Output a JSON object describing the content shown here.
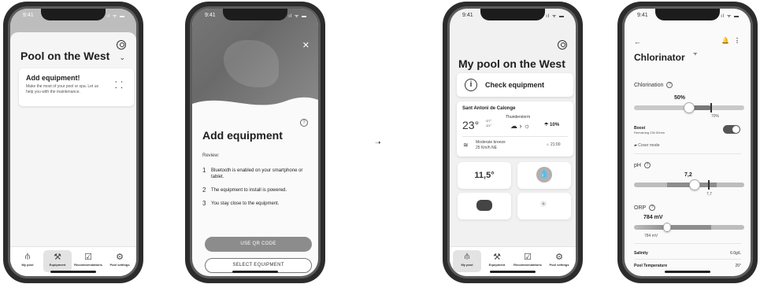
{
  "status": {
    "time": "9:41",
    "signal": "ıl ᯤ ▬"
  },
  "phone1": {
    "title": "Pool on the West",
    "card": {
      "title": "Add equipment!",
      "text": "Make the most of your pool or spa. Let us help you with the maintenance."
    },
    "tabs": [
      {
        "label": "My pool",
        "icon": "pool-ladder-icon",
        "glyph": "⫛"
      },
      {
        "label": "Equipment",
        "icon": "equipment-icon",
        "glyph": "⚒"
      },
      {
        "label": "Recommendations",
        "icon": "recommendations-icon",
        "glyph": "☑"
      },
      {
        "label": "Pool settings",
        "icon": "settings-icon",
        "glyph": "⚙"
      }
    ]
  },
  "phone2": {
    "title": "Add equipment",
    "review": "Review:",
    "steps": [
      {
        "n": "1",
        "text": "Bluetooth is enabled on your smartphone or tablet."
      },
      {
        "n": "2",
        "text": "The equipment to install is powered."
      },
      {
        "n": "3",
        "text": "You stay close to the equipment."
      }
    ],
    "btn_qr": "USE QR CODE",
    "btn_select": "SELECT EQUIPMENT"
  },
  "phone3": {
    "title": "My pool on the West",
    "check": "Check equipment",
    "weather": {
      "location": "Sant Antoni de Calonge",
      "temp": "23°",
      "max": "↑27°",
      "min": "↓21°",
      "condition": "Thunderstorm",
      "rain": "10%",
      "wind_line1": "Moderate breeze",
      "wind_line2": "25 Km/h NE",
      "sunset": "21:00"
    },
    "water_temp": "11,5°",
    "tabs": [
      {
        "label": "My pool",
        "icon": "pool-ladder-icon",
        "glyph": "⫛"
      },
      {
        "label": "Equipment",
        "icon": "equipment-icon",
        "glyph": "⚒"
      },
      {
        "label": "Recommendations",
        "icon": "recommendations-icon",
        "glyph": "☑"
      },
      {
        "label": "Pool settings",
        "icon": "settings-icon",
        "glyph": "⚙"
      }
    ]
  },
  "phone4": {
    "title": "Chlorinator",
    "chlorination": {
      "label": "Chlorination",
      "value": "50%",
      "target": "70%",
      "level": 0.5,
      "target_level": 0.7
    },
    "boost": {
      "label": "Boost",
      "sub": "Remaining 23h 50min",
      "on": true
    },
    "cover": "Cover mode",
    "ph": {
      "label": "pH",
      "value": "7,2",
      "target": "7,7",
      "level": 0.55,
      "target_level": 0.68
    },
    "orp": {
      "label": "ORP",
      "value": "784 mV",
      "target": "784 mV",
      "level": 0.3
    },
    "salinity": {
      "label": "Salinity",
      "value": "6.0g/L"
    },
    "pool_temp": {
      "label": "Pool Temperature",
      "value": "26°"
    }
  }
}
